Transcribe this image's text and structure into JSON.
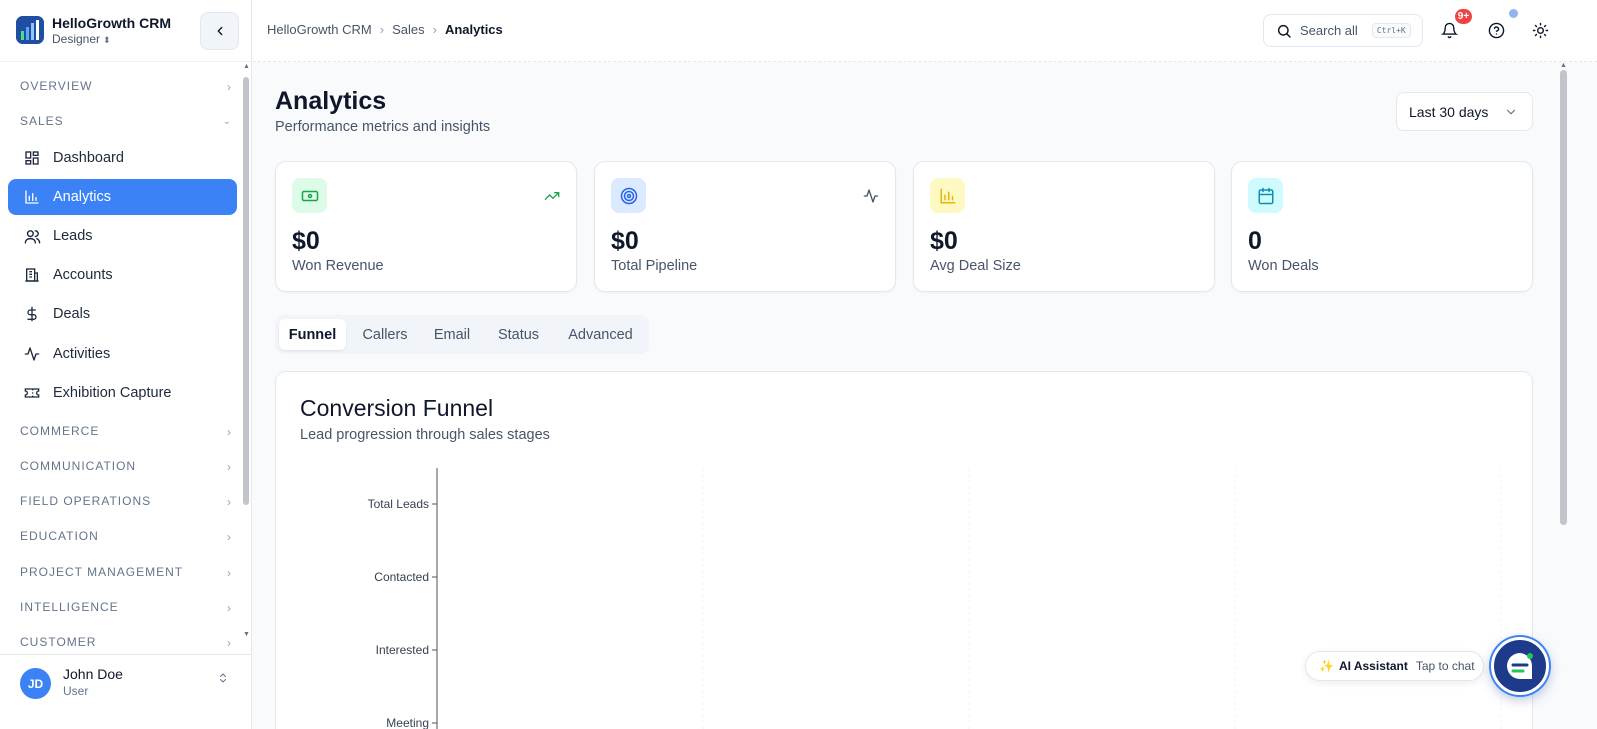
{
  "app": {
    "name": "HelloGrowth CRM",
    "workspace": "Designer",
    "logo_icon": "bar-chart-logo-icon"
  },
  "sidebar": {
    "sections": [
      {
        "label": "OVERVIEW",
        "expanded": false
      },
      {
        "label": "SALES",
        "expanded": true
      },
      {
        "label": "COMMERCE",
        "expanded": false
      },
      {
        "label": "COMMUNICATION",
        "expanded": false
      },
      {
        "label": "FIELD OPERATIONS",
        "expanded": false
      },
      {
        "label": "EDUCATION",
        "expanded": false
      },
      {
        "label": "PROJECT MANAGEMENT",
        "expanded": false
      },
      {
        "label": "INTELLIGENCE",
        "expanded": false
      },
      {
        "label": "CUSTOMER",
        "expanded": false
      }
    ],
    "sales_items": [
      {
        "label": "Dashboard",
        "icon": "grid-icon",
        "active": false
      },
      {
        "label": "Analytics",
        "icon": "bar-chart-icon",
        "active": true
      },
      {
        "label": "Leads",
        "icon": "users-icon",
        "active": false
      },
      {
        "label": "Accounts",
        "icon": "building-icon",
        "active": false
      },
      {
        "label": "Deals",
        "icon": "dollar-icon",
        "active": false
      },
      {
        "label": "Activities",
        "icon": "activity-icon",
        "active": false
      },
      {
        "label": "Exhibition Capture",
        "icon": "ticket-icon",
        "active": false
      }
    ]
  },
  "user": {
    "initials": "JD",
    "name": "John Doe",
    "role": "User"
  },
  "header": {
    "breadcrumb": [
      "HelloGrowth CRM",
      "Sales",
      "Analytics"
    ],
    "search_label": "Search all",
    "search_shortcut": "Ctrl+K",
    "notification_badge": "9+"
  },
  "page": {
    "title": "Analytics",
    "subtitle": "Performance metrics and insights",
    "range": "Last 30 days"
  },
  "metrics": [
    {
      "value": "$0",
      "label": "Won Revenue",
      "icon": "banknote-icon",
      "trend_icon": "trending-up-icon",
      "tint": "#dcfce7",
      "color": "#16a34a"
    },
    {
      "value": "$0",
      "label": "Total Pipeline",
      "icon": "target-icon",
      "trend_icon": "activity-icon",
      "tint": "#dbeafe",
      "color": "#2563eb"
    },
    {
      "value": "$0",
      "label": "Avg Deal Size",
      "icon": "bar-chart-icon",
      "trend_icon": "",
      "tint": "#fef9c3",
      "color": "#eab308"
    },
    {
      "value": "0",
      "label": "Won Deals",
      "icon": "calendar-icon",
      "trend_icon": "",
      "tint": "#cffafe",
      "color": "#0891b2"
    }
  ],
  "tabs": [
    {
      "label": "Funnel",
      "active": true
    },
    {
      "label": "Callers",
      "active": false
    },
    {
      "label": "Email",
      "active": false
    },
    {
      "label": "Status",
      "active": false
    },
    {
      "label": "Advanced",
      "active": false
    }
  ],
  "funnel": {
    "title": "Conversion Funnel",
    "subtitle": "Lead progression through sales stages"
  },
  "chart_data": {
    "type": "bar",
    "orientation": "horizontal",
    "title": "Conversion Funnel",
    "subtitle": "Lead progression through sales stages",
    "categories": [
      "Total Leads",
      "Contacted",
      "Interested",
      "Meeting"
    ],
    "values": [
      0,
      0,
      0,
      0
    ],
    "grid": true
  },
  "assistant": {
    "title": "AI Assistant",
    "hint": "Tap to chat"
  },
  "colors": {
    "accent": "#3b82f6",
    "badge": "#ef4444"
  }
}
